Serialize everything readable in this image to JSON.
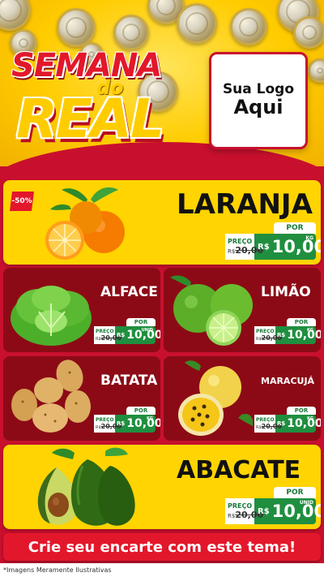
{
  "header": {
    "title_line1": "SEMANA",
    "title_connector": "do",
    "title_line2": "REAL",
    "logo_line1": "Sua Logo",
    "logo_line2": "Aqui"
  },
  "products": {
    "laranja": {
      "name": "LARANJA",
      "badge": "-50%",
      "por": "POR",
      "preco": "PREÇO",
      "old_prefix": "R$",
      "old_price": "20,00",
      "currency": "R$",
      "price": "10,00",
      "unit": "KG"
    },
    "alface": {
      "name": "ALFACE",
      "por": "POR",
      "preco": "PREÇO",
      "old_prefix": "R$",
      "old_price": "20,00",
      "currency": "R$",
      "price": "10,00",
      "unit": "UNID"
    },
    "limao": {
      "name": "LIMÃO",
      "por": "POR",
      "preco": "PREÇO",
      "old_prefix": "R$",
      "old_price": "20,00",
      "currency": "R$",
      "price": "10,00",
      "unit": "KG"
    },
    "batata": {
      "name": "BATATA",
      "por": "POR",
      "preco": "PREÇO",
      "old_prefix": "R$",
      "old_price": "20,00",
      "currency": "R$",
      "price": "10,00",
      "unit": "KG"
    },
    "maracuja": {
      "name": "MARACUJÁ",
      "por": "POR",
      "preco": "PREÇO",
      "old_prefix": "R$",
      "old_price": "20,00",
      "currency": "R$",
      "price": "10,00",
      "unit": "KG"
    },
    "abacate": {
      "name": "ABACATE",
      "por": "POR",
      "preco": "PREÇO",
      "old_prefix": "R$",
      "old_price": "20,00",
      "currency": "R$",
      "price": "10,00",
      "unit": "UNID"
    }
  },
  "footer": {
    "cta": "Crie seu encarte com este tema!",
    "disclaimer": "*Imagens Meramente Ilustrativas"
  },
  "colors": {
    "primary_red": "#c8102e",
    "accent_yellow": "#ffd400",
    "price_green": "#1f8f3f",
    "card_dark_red": "#8c0a16"
  },
  "icons": [
    "coin-icon",
    "orange-icon",
    "lettuce-icon",
    "lime-icon",
    "potato-icon",
    "passion-fruit-icon",
    "avocado-icon"
  ]
}
